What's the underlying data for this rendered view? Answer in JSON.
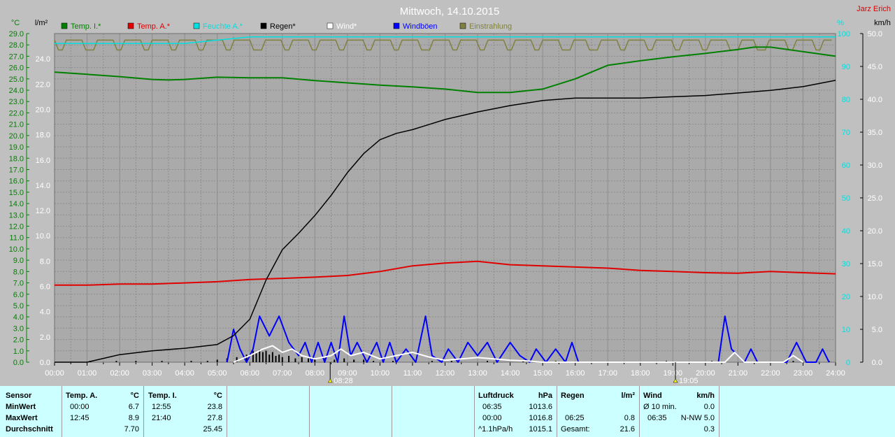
{
  "title": "Mittwoch, 14.10.2015",
  "author": "Jarz Erich",
  "colors": {
    "plot_bg": "#aaaaaa",
    "grid": "#8c8c8c",
    "temp_i": "#008000",
    "temp_a": "#e00000",
    "feuchte": "#00e0e0",
    "regen": "#000000",
    "wind": "#ffffff",
    "windboen": "#0000ff",
    "einstrahlung": "#808040",
    "table_bg": "#ccffff"
  },
  "legend": [
    {
      "label": "Temp. I.*",
      "color": "#008000"
    },
    {
      "label": "Temp. A.*",
      "color": "#e00000"
    },
    {
      "label": "Feuchte A.*",
      "color": "#00e0e0"
    },
    {
      "label": "Regen*",
      "color": "#000000"
    },
    {
      "label": "Wind*",
      "color": "#ffffff"
    },
    {
      "label": "Windböen",
      "color": "#0000ff"
    },
    {
      "label": "Einstrahlung",
      "color": "#808040"
    }
  ],
  "axis_units": {
    "temp": "°C",
    "rain": "l/m²",
    "humidity": "%",
    "wind": "km/h"
  },
  "markers": [
    {
      "time": 8.47,
      "label": "08:28"
    },
    {
      "time": 19.08,
      "label": "19:05"
    }
  ],
  "chart_data": {
    "type": "line",
    "title": "Mittwoch, 14.10.2015",
    "x_unit": "Uhrzeit",
    "x_ticks": [
      "00:00",
      "01:00",
      "02:00",
      "03:00",
      "04:00",
      "05:00",
      "06:00",
      "07:00",
      "08:00",
      "09:00",
      "10:00",
      "11:00",
      "12:00",
      "13:00",
      "14:00",
      "15:00",
      "16:00",
      "17:00",
      "18:00",
      "19:00",
      "20:00",
      "21:00",
      "22:00",
      "23:00",
      "24:00"
    ],
    "xlim": [
      0,
      24
    ],
    "axes": {
      "temp": {
        "label": "°C",
        "lim": [
          0,
          29
        ],
        "ticks": [
          "29.0",
          "28.0",
          "27.0",
          "26.0",
          "25.0",
          "24.0",
          "23.0",
          "22.0",
          "21.0",
          "20.0",
          "19.0",
          "18.0",
          "17.0",
          "16.0",
          "15.0",
          "14.0",
          "13.0",
          "12.0",
          "11.0",
          "10.0",
          "9.0",
          "8.0",
          "7.0",
          "6.0",
          "5.0",
          "4.0",
          "3.0",
          "2.0",
          "1.0",
          "0.0"
        ]
      },
      "rain": {
        "label": "l/m²",
        "lim": [
          0,
          26
        ],
        "ticks": [
          "24.0",
          "22.0",
          "20.0",
          "18.0",
          "16.0",
          "14.0",
          "12.0",
          "10.0",
          "8.0",
          "6.0",
          "4.0",
          "2.0",
          "0.0"
        ]
      },
      "humidity": {
        "label": "%",
        "lim": [
          0,
          100
        ],
        "ticks": [
          "100",
          "90",
          "80",
          "70",
          "60",
          "50",
          "40",
          "30",
          "20",
          "10",
          "0"
        ]
      },
      "wind": {
        "label": "km/h",
        "lim": [
          0,
          50
        ],
        "ticks": [
          "50.0",
          "45.0",
          "40.0",
          "35.0",
          "30.0",
          "25.0",
          "20.0",
          "15.0",
          "10.0",
          "5.0",
          "0.0"
        ]
      }
    },
    "grid": true,
    "series": [
      {
        "name": "Temp. I.*",
        "axis": "temp",
        "color": "#008000",
        "x": [
          0,
          1,
          2,
          3,
          3.5,
          4,
          5,
          6,
          7,
          8,
          9,
          10,
          11,
          12,
          13,
          14,
          15,
          16,
          16.5,
          17,
          18,
          19,
          20,
          21,
          21.5,
          22,
          23,
          24
        ],
        "y": [
          25.6,
          25.4,
          25.2,
          24.95,
          24.9,
          24.95,
          25.15,
          25.1,
          25.1,
          24.85,
          24.65,
          24.45,
          24.3,
          24.1,
          23.8,
          23.8,
          24.1,
          25.0,
          25.6,
          26.2,
          26.6,
          26.95,
          27.25,
          27.6,
          27.8,
          27.8,
          27.4,
          27.0
        ]
      },
      {
        "name": "Temp. A.*",
        "axis": "temp",
        "color": "#e00000",
        "x": [
          0,
          1,
          2,
          3,
          4,
          5,
          6,
          7,
          8,
          9,
          10,
          11,
          12,
          13,
          14,
          15,
          16,
          17,
          18,
          19,
          20,
          21,
          22,
          23,
          24
        ],
        "y": [
          6.8,
          6.8,
          6.9,
          6.9,
          7.0,
          7.1,
          7.3,
          7.4,
          7.5,
          7.65,
          8.0,
          8.5,
          8.75,
          8.9,
          8.6,
          8.5,
          8.4,
          8.3,
          8.1,
          8.0,
          7.9,
          7.85,
          8.0,
          7.9,
          7.8
        ]
      },
      {
        "name": "Feuchte A.*",
        "axis": "humidity",
        "color": "#00e0e0",
        "x": [
          0,
          4,
          5,
          6,
          24
        ],
        "y": [
          97,
          97,
          98,
          99,
          99
        ]
      },
      {
        "name": "Regen*",
        "axis": "rain",
        "color": "#000000",
        "x": [
          0,
          1,
          2,
          3,
          4,
          5,
          5.5,
          6,
          6.5,
          7,
          7.5,
          8,
          8.5,
          9,
          9.5,
          10,
          10.5,
          11,
          11.5,
          12,
          13,
          14,
          15,
          16,
          17,
          18,
          19,
          20,
          21,
          22,
          23,
          24
        ],
        "y": [
          0,
          0,
          0.6,
          0.9,
          1.1,
          1.4,
          2.1,
          3.4,
          6.5,
          8.9,
          10.2,
          11.6,
          13.2,
          15.0,
          16.5,
          17.6,
          18.1,
          18.4,
          18.8,
          19.2,
          19.8,
          20.3,
          20.7,
          20.9,
          20.9,
          20.9,
          21.0,
          21.1,
          21.3,
          21.5,
          21.8,
          22.3
        ]
      },
      {
        "name": "Windböen",
        "axis": "wind",
        "color": "#0000ff",
        "x": [
          5.3,
          5.5,
          5.7,
          5.9,
          6.1,
          6.3,
          6.6,
          6.9,
          7.2,
          7.5,
          7.7,
          7.9,
          8.1,
          8.3,
          8.5,
          8.7,
          8.9,
          9.1,
          9.3,
          9.6,
          9.9,
          10.1,
          10.3,
          10.5,
          10.8,
          11.1,
          11.4,
          11.6,
          11.9,
          12.1,
          12.4,
          12.7,
          13.0,
          13.3,
          13.6,
          14.0,
          14.3,
          14.6,
          14.8,
          15.1,
          15.4,
          15.7,
          15.9,
          16.1,
          16.3,
          20.4,
          20.6,
          20.8,
          21.0,
          21.2,
          21.4,
          21.6,
          21.9,
          22.2,
          22.5,
          22.8,
          23.1,
          23.4,
          23.6,
          23.8
        ],
        "y": [
          0,
          5,
          2,
          0,
          2,
          7,
          4,
          7,
          3,
          1,
          3,
          0,
          3,
          0,
          3,
          0,
          7,
          1,
          3,
          0,
          3,
          0,
          3,
          0,
          2,
          0,
          7,
          1,
          0,
          2,
          0,
          3,
          1,
          3,
          0,
          3,
          1,
          0,
          2,
          0,
          2,
          0,
          3,
          0,
          0,
          0,
          7,
          2,
          1,
          0,
          2,
          0,
          0,
          0,
          0,
          3,
          0,
          0,
          2,
          0
        ]
      },
      {
        "name": "Wind*",
        "axis": "wind",
        "color": "#ffffff",
        "x": [
          5.5,
          6.0,
          6.4,
          6.7,
          7.0,
          7.3,
          7.6,
          8.0,
          8.5,
          8.8,
          9.1,
          9.5,
          10.0,
          10.5,
          11.0,
          11.5,
          12.0,
          12.5,
          13.0,
          13.5,
          14.0,
          14.5,
          15.0,
          15.5,
          20.6,
          20.9,
          21.2,
          22.4,
          22.7,
          23.0
        ],
        "y": [
          0,
          1,
          2,
          2.5,
          1.5,
          2,
          1,
          0.5,
          1,
          2,
          1,
          1.5,
          0.5,
          1,
          1.5,
          0.8,
          0.3,
          0.5,
          0.7,
          0.5,
          0.3,
          0.2,
          0,
          0,
          0,
          1.5,
          0,
          0,
          1,
          0
        ]
      },
      {
        "name": "Einstrahlung",
        "axis": "humidity",
        "color": "#808040",
        "x": [
          0,
          24
        ],
        "y": [
          98,
          98
        ]
      }
    ],
    "rain_bars": {
      "axis": "rain",
      "x": [
        1.1,
        1.9,
        2.5,
        3.3,
        4.2,
        4.7,
        5.0,
        5.3,
        5.6,
        5.9,
        6.1,
        6.2,
        6.3,
        6.4,
        6.5,
        6.6,
        6.7,
        6.8,
        6.9,
        7.0,
        7.2,
        7.4,
        7.6,
        7.8,
        8.0,
        8.3,
        8.6,
        8.9,
        9.2,
        9.5,
        9.8,
        10.4,
        11.6,
        12.2,
        13.3,
        14.4,
        15.4,
        18.8,
        20.2,
        22.7,
        23.8
      ],
      "y": [
        0.1,
        0.1,
        0.1,
        0.1,
        0.1,
        0.1,
        0.2,
        0.3,
        0.4,
        0.6,
        0.9,
        0.7,
        1.0,
        0.8,
        0.9,
        0.6,
        0.8,
        0.5,
        0.6,
        0.4,
        0.5,
        0.3,
        0.4,
        0.3,
        0.3,
        0.3,
        0.2,
        0.3,
        0.2,
        0.2,
        0.1,
        0.1,
        0.1,
        0.1,
        0.1,
        0.1,
        0.1,
        0.1,
        0.1,
        0.1,
        0.1
      ]
    }
  },
  "table": {
    "sensor": {
      "header": "Sensor",
      "rows": [
        "MinWert",
        "MaxWert",
        "Durchschnitt"
      ]
    },
    "temp_a": {
      "header": "Temp. A.",
      "unit": "°C",
      "rows": [
        {
          "time": "00:00",
          "value": "6.7"
        },
        {
          "time": "12:45",
          "value": "8.9"
        },
        {
          "time": "",
          "value": "7.70"
        }
      ]
    },
    "temp_i": {
      "header": "Temp. I.",
      "unit": "°C",
      "rows": [
        {
          "time": "12:55",
          "value": "23.8"
        },
        {
          "time": "21:40",
          "value": "27.8"
        },
        {
          "time": "",
          "value": "25.45"
        }
      ]
    },
    "luftdruck": {
      "header": "Luftdruck",
      "unit": "hPa",
      "rows": [
        {
          "time": "06:35",
          "value": "1013.6"
        },
        {
          "time": "00:00",
          "value": "1016.8"
        },
        {
          "time": "^1.1hPa/h",
          "value": "1015.1"
        }
      ]
    },
    "regen": {
      "header": "Regen",
      "unit": "l/m²",
      "rows": [
        {
          "time": "",
          "value": ""
        },
        {
          "time": "06:25",
          "value": "0.8"
        },
        {
          "time": "Gesamt:",
          "value": "21.6"
        }
      ]
    },
    "wind": {
      "header": "Wind",
      "unit": "km/h",
      "rows": [
        {
          "time": "Ø 10 min.",
          "value": "0.0"
        },
        {
          "time": "06:35",
          "value": "N-NW 5.0"
        },
        {
          "time": "",
          "value": "0.3"
        }
      ]
    }
  }
}
